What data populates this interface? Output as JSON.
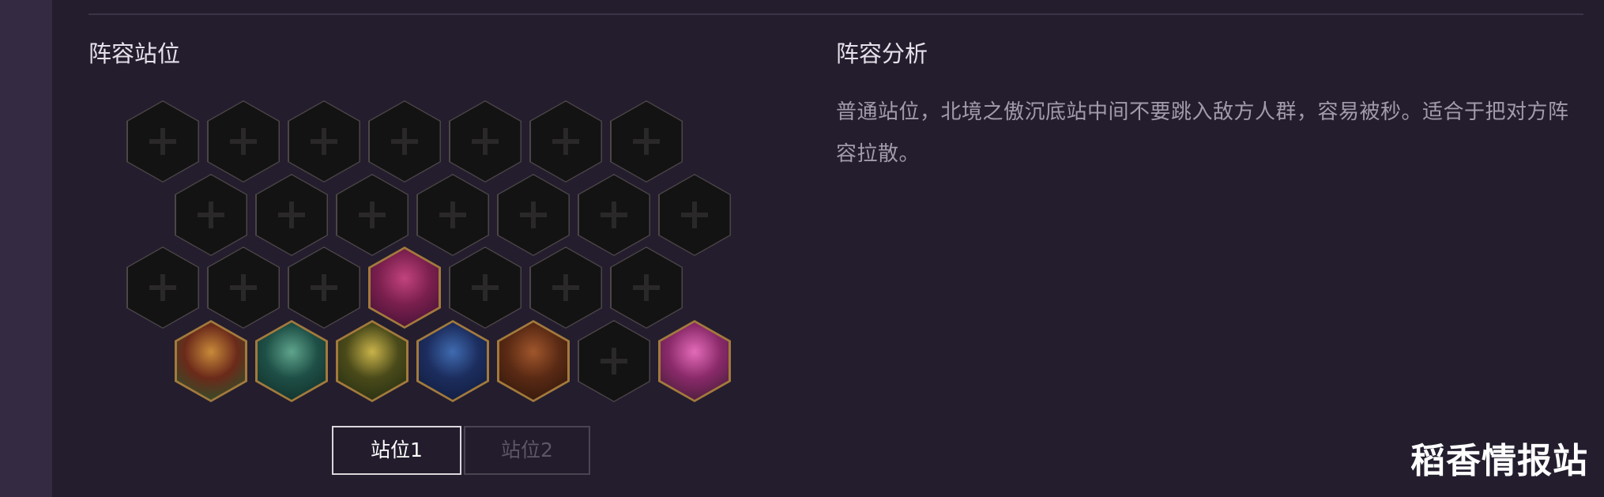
{
  "sections": {
    "lineup_position_title": "阵容站位",
    "lineup_analysis_title": "阵容分析"
  },
  "analysis": {
    "text": "普通站位，北境之傲沉底站中间不要跳入敌方人群，容易被秒。适合于把对方阵容拉散。"
  },
  "board": {
    "rows": [
      [
        "empty",
        "empty",
        "empty",
        "empty",
        "empty",
        "empty",
        "empty"
      ],
      [
        "empty",
        "empty",
        "empty",
        "empty",
        "empty",
        "empty",
        "empty"
      ],
      [
        "empty",
        "empty",
        "empty",
        "champion-magenta-beast",
        "empty",
        "empty",
        "empty"
      ],
      [
        "champion-masked-hunter",
        "champion-jade-dragon",
        "champion-gold-ninja",
        "champion-blue-beast",
        "champion-monkey",
        "empty",
        "champion-pink-haired"
      ]
    ],
    "champion_colors": {
      "champion-magenta-beast": [
        "#7a1f4e",
        "#c2437d",
        "#3a1030"
      ],
      "champion-masked-hunter": [
        "#6b2a1a",
        "#c98a3a",
        "#1f5a2f"
      ],
      "champion-jade-dragon": [
        "#1e4f46",
        "#5fa48c",
        "#0f2a26"
      ],
      "champion-gold-ninja": [
        "#4a4a1a",
        "#c9b34a",
        "#1f2a10"
      ],
      "champion-blue-beast": [
        "#1c2d5e",
        "#3f6bb0",
        "#0f1a38"
      ],
      "champion-monkey": [
        "#5a2a14",
        "#a0562c",
        "#2b140a"
      ],
      "champion-pink-haired": [
        "#8a2a6a",
        "#e36bb8",
        "#3a1a2e"
      ]
    }
  },
  "tabs": [
    {
      "label": "站位1",
      "active": true
    },
    {
      "label": "站位2",
      "active": false
    }
  ],
  "watermark": "稻香情报站"
}
